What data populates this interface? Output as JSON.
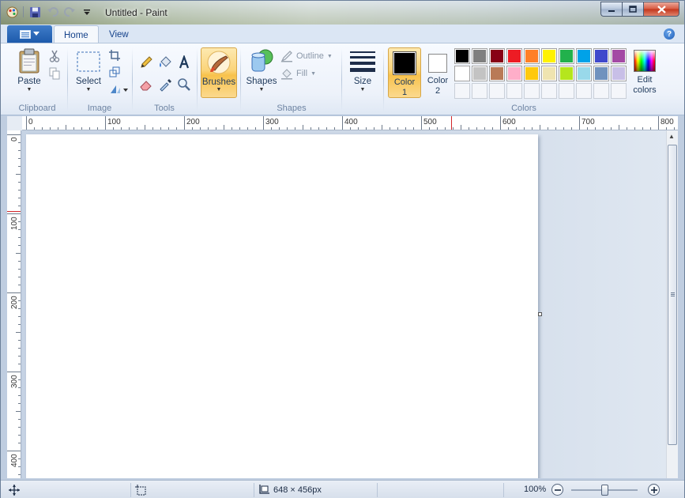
{
  "window": {
    "title": "Untitled - Paint"
  },
  "tabs": {
    "home": "Home",
    "view": "View"
  },
  "clipboard": {
    "group": "Clipboard",
    "paste": "Paste"
  },
  "image": {
    "group": "Image",
    "select": "Select"
  },
  "tools": {
    "group": "Tools"
  },
  "brushes": {
    "label": "Brushes"
  },
  "shapes": {
    "group": "Shapes",
    "label": "Shapes",
    "outline": "Outline",
    "fill": "Fill"
  },
  "size": {
    "label": "Size"
  },
  "colors": {
    "group": "Colors",
    "color1_line1": "Color",
    "color1_line2": "1",
    "color2_line1": "Color",
    "color2_line2": "2",
    "edit_line1": "Edit",
    "edit_line2": "colors",
    "color1_value": "#000000",
    "color2_value": "#ffffff",
    "palette_row1": [
      "#000000",
      "#7f7f7f",
      "#880015",
      "#ed1c24",
      "#ff7f27",
      "#fff200",
      "#22b14c",
      "#00a2e8",
      "#3f48cc",
      "#a349a4"
    ],
    "palette_row2": [
      "#ffffff",
      "#c3c3c3",
      "#b97a57",
      "#ffaec9",
      "#ffc90e",
      "#efe4b0",
      "#b5e61d",
      "#99d9ea",
      "#7092be",
      "#c8bfe7"
    ]
  },
  "ruler": {
    "h": [
      "0",
      "100",
      "200",
      "300",
      "400",
      "500",
      "600",
      "700",
      "800"
    ],
    "v": [
      "0",
      "100",
      "200",
      "300",
      "400"
    ]
  },
  "status": {
    "size": "648 × 456px",
    "zoom": "100%"
  }
}
